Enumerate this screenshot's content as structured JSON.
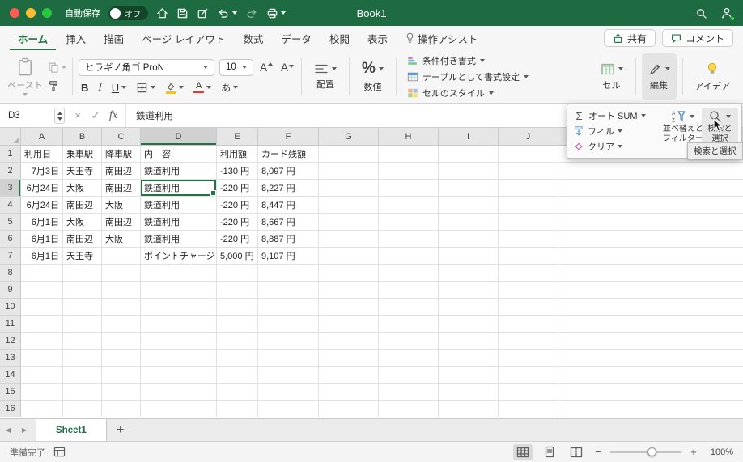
{
  "titlebar": {
    "autosave_label": "自動保存",
    "autosave_state": "オフ",
    "title": "Book1"
  },
  "ribbon_tabs": {
    "items": [
      "ホーム",
      "挿入",
      "描画",
      "ページ レイアウト",
      "数式",
      "データ",
      "校閲",
      "表示",
      "操作アシスト"
    ],
    "active": "ホーム",
    "share_label": "共有",
    "comments_label": "コメント"
  },
  "ribbon": {
    "paste_label": "ペースト",
    "font_name": "ヒラギノ角ゴ ProN",
    "font_size": "10",
    "increase_font_label": "A",
    "decrease_font_label": "A",
    "bold_label": "B",
    "italic_label": "I",
    "underline_label": "U",
    "font_color_label": "A",
    "phonetic_label": "あ",
    "align_label": "配置",
    "percent_label": "%",
    "number_label": "数値",
    "conditional_format_label": "条件付き書式",
    "format_table_label": "テーブルとして書式設定",
    "cell_styles_label": "セルのスタイル",
    "cells_label": "セル",
    "editing_label": "編集",
    "ideas_label": "アイデア"
  },
  "editing_menu": {
    "autosum_icon": "Σ",
    "autosum_label": "オート SUM",
    "fill_label": "フィル",
    "clear_label": "クリア",
    "sort_filter_line1": "並べ替えと",
    "sort_filter_line2": "フィルター",
    "find_select_line1": "検索と",
    "find_select_line2": "選択",
    "tooltip": "検索と選択"
  },
  "formula_bar": {
    "name_box": "D3",
    "cancel_glyph": "×",
    "enter_glyph": "✓",
    "fx_label": "fx",
    "content": "鉄道利用"
  },
  "grid": {
    "col_headers": [
      "A",
      "B",
      "C",
      "D",
      "E",
      "F",
      "G",
      "H",
      "I",
      "J"
    ],
    "visible_rows": 16,
    "selected_cell": {
      "col": "D",
      "row": 3
    },
    "rows": [
      {
        "r": 1,
        "cells": [
          "利用日",
          "乗車駅",
          "降車駅",
          "内　容",
          "利用額",
          "カード残額"
        ]
      },
      {
        "r": 2,
        "cells": [
          "7月3日",
          "天王寺",
          "南田辺",
          "鉄道利用",
          "-130 円",
          "8,097 円"
        ]
      },
      {
        "r": 3,
        "cells": [
          "6月24日",
          "大阪",
          "南田辺",
          "鉄道利用",
          "-220 円",
          "8,227 円"
        ]
      },
      {
        "r": 4,
        "cells": [
          "6月24日",
          "南田辺",
          "大阪",
          "鉄道利用",
          "-220 円",
          "8,447 円"
        ]
      },
      {
        "r": 5,
        "cells": [
          "6月1日",
          "大阪",
          "南田辺",
          "鉄道利用",
          "-220 円",
          "8,667 円"
        ]
      },
      {
        "r": 6,
        "cells": [
          "6月1日",
          "南田辺",
          "大阪",
          "鉄道利用",
          "-220 円",
          "8,887 円"
        ]
      },
      {
        "r": 7,
        "cells": [
          "6月1日",
          "天王寺",
          "",
          "ポイントチャージ",
          "5,000 円",
          "9,107 円"
        ]
      }
    ]
  },
  "sheetbar": {
    "tabs": [
      "Sheet1"
    ],
    "active_tab": "Sheet1"
  },
  "statusbar": {
    "status": "準備完了",
    "zoom": "100%"
  },
  "colors": {
    "accent_green": "#217346",
    "titlebar_green": "#1e6b41",
    "selection_green": "#217346"
  }
}
